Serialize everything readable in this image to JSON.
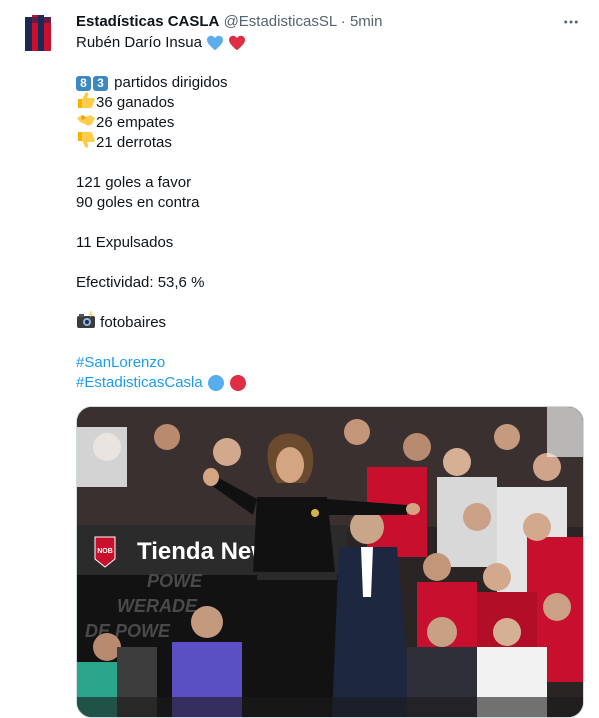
{
  "author": {
    "name": "Estadísticas CASLA",
    "handle": "@EstadisticasSL",
    "separator": "·",
    "time": "5min"
  },
  "menu_icon": "more-horizontal-icon",
  "tweet": {
    "line1": "Rubén Darío Insua",
    "line1_emoji": [
      "blue-heart-icon",
      "red-heart-icon"
    ],
    "matches_digits": [
      "8",
      "3"
    ],
    "matches_text": " partidos dirigidos",
    "wins": "36 ganados",
    "draws": "26 empates",
    "losses": "21 derrotas",
    "goals_for": "121 goles a favor",
    "goals_against": "90 goles en contra",
    "expulsions": "11 Expulsados",
    "effectiveness": "Efectividad: 53,6 %",
    "photo_credit": " fotobaires",
    "hashtag1": "#SanLorenzo",
    "hashtag2": "#EstadisticasCasla",
    "hashtag2_emoji": [
      "blue-circle-icon",
      "red-circle-icon"
    ]
  },
  "media": {
    "banner_text": "Tienda New",
    "banner_badge": "NOB",
    "ad_text_1": "POWE",
    "ad_text_2": "WERADE",
    "ad_text_3": "DE POWE",
    "colors": {
      "shirt": "#111111",
      "stand_red": "#c8102e",
      "banner": "#2b2b2b"
    }
  },
  "colors": {
    "link": "#1d9bf0",
    "muted": "#536471",
    "text": "#0f1419"
  }
}
